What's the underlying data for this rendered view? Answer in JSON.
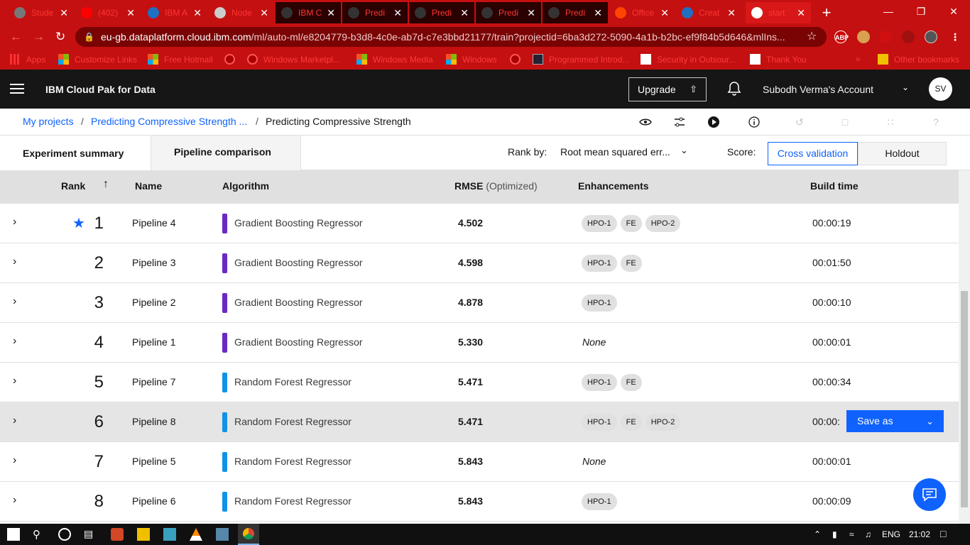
{
  "browser": {
    "tabs": [
      {
        "title": "Stude",
        "color": "#777777"
      },
      {
        "title": "(402)",
        "color": "#ff0000"
      },
      {
        "title": "IBM A",
        "color": "#1f70c1"
      },
      {
        "title": "Node",
        "color": "#cccccc"
      },
      {
        "title": "IBM C",
        "color": "#333333"
      },
      {
        "title": "Predi",
        "color": "#333333"
      },
      {
        "title": "Predi",
        "color": "#333333"
      },
      {
        "title": "Predi",
        "color": "#333333"
      },
      {
        "title": "Predi",
        "color": "#333333"
      },
      {
        "title": "Office",
        "color": "#ff4500"
      },
      {
        "title": "Creat",
        "color": "#1f70c1"
      },
      {
        "title": "start",
        "color": "#ffffff"
      }
    ],
    "url_host": "eu-gb.dataplatform.cloud.ibm.com",
    "url_path": "/ml/auto-ml/e8204779-b3d8-4c0e-ab7d-c7e3bbd21177/train?projectid=6ba3d272-5090-4a1b-b2bc-ef9f84b5d646&mlIns...",
    "extensions": [
      "ABP"
    ],
    "bookmarks": [
      {
        "label": "Apps"
      },
      {
        "label": "Customize Links"
      },
      {
        "label": "Free Hotmail"
      },
      {
        "label": ""
      },
      {
        "label": "Windows Marketpl..."
      },
      {
        "label": "Windows Media"
      },
      {
        "label": "Windows"
      },
      {
        "label": ""
      },
      {
        "label": "Programmed Introd..."
      },
      {
        "label": "Security in Outsour..."
      },
      {
        "label": "Thank You"
      },
      {
        "label": "»"
      },
      {
        "label": "Other bookmarks"
      }
    ]
  },
  "header": {
    "brand": "IBM Cloud Pak for Data",
    "upgrade_label": "Upgrade",
    "account": "Subodh Verma's Account",
    "avatar": "SV"
  },
  "breadcrumb": {
    "items": [
      "My projects",
      "Predicting Compressive Strength ...",
      "Predicting Compressive Strength"
    ],
    "separator": "/"
  },
  "tabs": {
    "summary": "Experiment summary",
    "comparison": "Pipeline comparison"
  },
  "controls": {
    "rank_by_label": "Rank by:",
    "rank_by_value": "Root mean squared err...",
    "score_label": "Score:",
    "score_options": [
      "Cross validation",
      "Holdout"
    ]
  },
  "table": {
    "headers": {
      "rank": "Rank",
      "name": "Name",
      "algorithm": "Algorithm",
      "rmse": "RMSE",
      "rmse_sub": "(Optimized)",
      "enhancements": "Enhancements",
      "build_time": "Build time"
    },
    "save_as_label": "Save as",
    "none_label": "None",
    "rows": [
      {
        "rank": "1",
        "name": "Pipeline 4",
        "algorithm": "Gradient Boosting Regressor",
        "color": "#6929c4",
        "rmse": "4.502",
        "enh": [
          "HPO-1",
          "FE",
          "HPO-2"
        ],
        "time": "00:00:19",
        "starred": true
      },
      {
        "rank": "2",
        "name": "Pipeline 3",
        "algorithm": "Gradient Boosting Regressor",
        "color": "#6929c4",
        "rmse": "4.598",
        "enh": [
          "HPO-1",
          "FE"
        ],
        "time": "00:01:50"
      },
      {
        "rank": "3",
        "name": "Pipeline 2",
        "algorithm": "Gradient Boosting Regressor",
        "color": "#6929c4",
        "rmse": "4.878",
        "enh": [
          "HPO-1"
        ],
        "time": "00:00:10"
      },
      {
        "rank": "4",
        "name": "Pipeline 1",
        "algorithm": "Gradient Boosting Regressor",
        "color": "#6929c4",
        "rmse": "5.330",
        "enh": [],
        "time": "00:00:01"
      },
      {
        "rank": "5",
        "name": "Pipeline 7",
        "algorithm": "Random Forest Regressor",
        "color": "#1192e8",
        "rmse": "5.471",
        "enh": [
          "HPO-1",
          "FE"
        ],
        "time": "00:00:34"
      },
      {
        "rank": "6",
        "name": "Pipeline 8",
        "algorithm": "Random Forest Regressor",
        "color": "#1192e8",
        "rmse": "5.471",
        "enh": [
          "HPO-1",
          "FE",
          "HPO-2"
        ],
        "time": "00:00:",
        "hover": true
      },
      {
        "rank": "7",
        "name": "Pipeline 5",
        "algorithm": "Random Forest Regressor",
        "color": "#1192e8",
        "rmse": "5.843",
        "enh": [],
        "time": "00:00:01"
      },
      {
        "rank": "8",
        "name": "Pipeline 6",
        "algorithm": "Random Forest Regressor",
        "color": "#1192e8",
        "rmse": "5.843",
        "enh": [
          "HPO-1"
        ],
        "time": "00:00:09"
      }
    ]
  },
  "taskbar": {
    "lang": "ENG",
    "time": "21:02"
  }
}
